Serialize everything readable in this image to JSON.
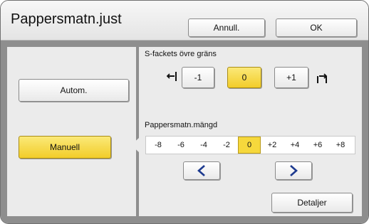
{
  "header": {
    "title": "Pappersmatn.just",
    "cancel_label": "Annull.",
    "ok_label": "OK"
  },
  "mode": {
    "auto_label": "Autom.",
    "manual_label": "Manuell",
    "selected": "Manuell"
  },
  "s_tray": {
    "label": "S-fackets övre gräns",
    "left_icon": "tray-lower-icon",
    "right_icon": "tray-upper-icon",
    "buttons": [
      "-1",
      "0",
      "+1"
    ],
    "selected_value": "0"
  },
  "feed_amount": {
    "label": "Pappersmatn.mängd",
    "scale": [
      "-8",
      "-6",
      "-4",
      "-2",
      "0",
      "+2",
      "+4",
      "+6",
      "+8"
    ],
    "selected_value": "0",
    "decrease_icon": "chevron-left-icon",
    "increase_icon": "chevron-right-icon"
  },
  "details_label": "Detaljer",
  "colors": {
    "accent_yellow": "#f6d83c",
    "panel_gray": "#ebebeb",
    "background_gray": "#8e8e8e"
  }
}
